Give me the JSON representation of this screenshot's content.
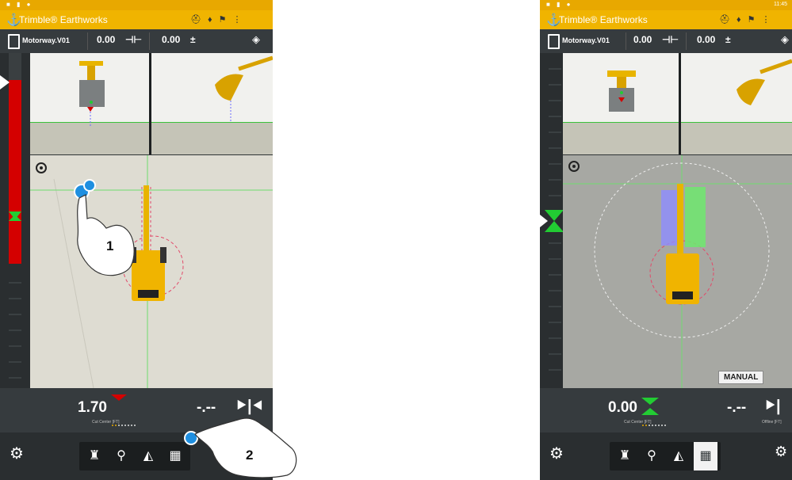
{
  "status_bar": {
    "time": "11:45"
  },
  "app": {
    "title": "Trimble® Earthworks"
  },
  "infobar": {
    "design_name": "Motorway.V01",
    "cross_slope": "0.00",
    "main_slope": "0.00"
  },
  "cut_panel": {
    "left": {
      "cut_center_value": "1.70",
      "cut_label": "Cut Center [FT]"
    },
    "right": {
      "cut_center_value": "0.00",
      "cut_label": "Cut Center [FT]"
    },
    "offline_value": "-.--",
    "offline_label": "Offline [FT]"
  },
  "mode_indicator": {
    "label": "MANUAL"
  },
  "callouts": {
    "step1": "1",
    "step2": "2"
  },
  "nav": {
    "active_tab_left": "none",
    "active_tab_right": "map"
  },
  "colors": {
    "brand_yellow": "#f0b400",
    "guidance_red": "#d40000",
    "guidance_green": "#22cc33",
    "touch_blue": "#1f8fe0"
  },
  "icons": [
    "doc-icon",
    "cross-slope-icon",
    "main-slope-icon",
    "layers-icon",
    "excavator-view-icon",
    "profile-view-icon",
    "cross-section-view-icon",
    "plan-view-icon",
    "settings-icon",
    "machine-settings-icon",
    "offline-arrows-icon",
    "compass-icon"
  ]
}
